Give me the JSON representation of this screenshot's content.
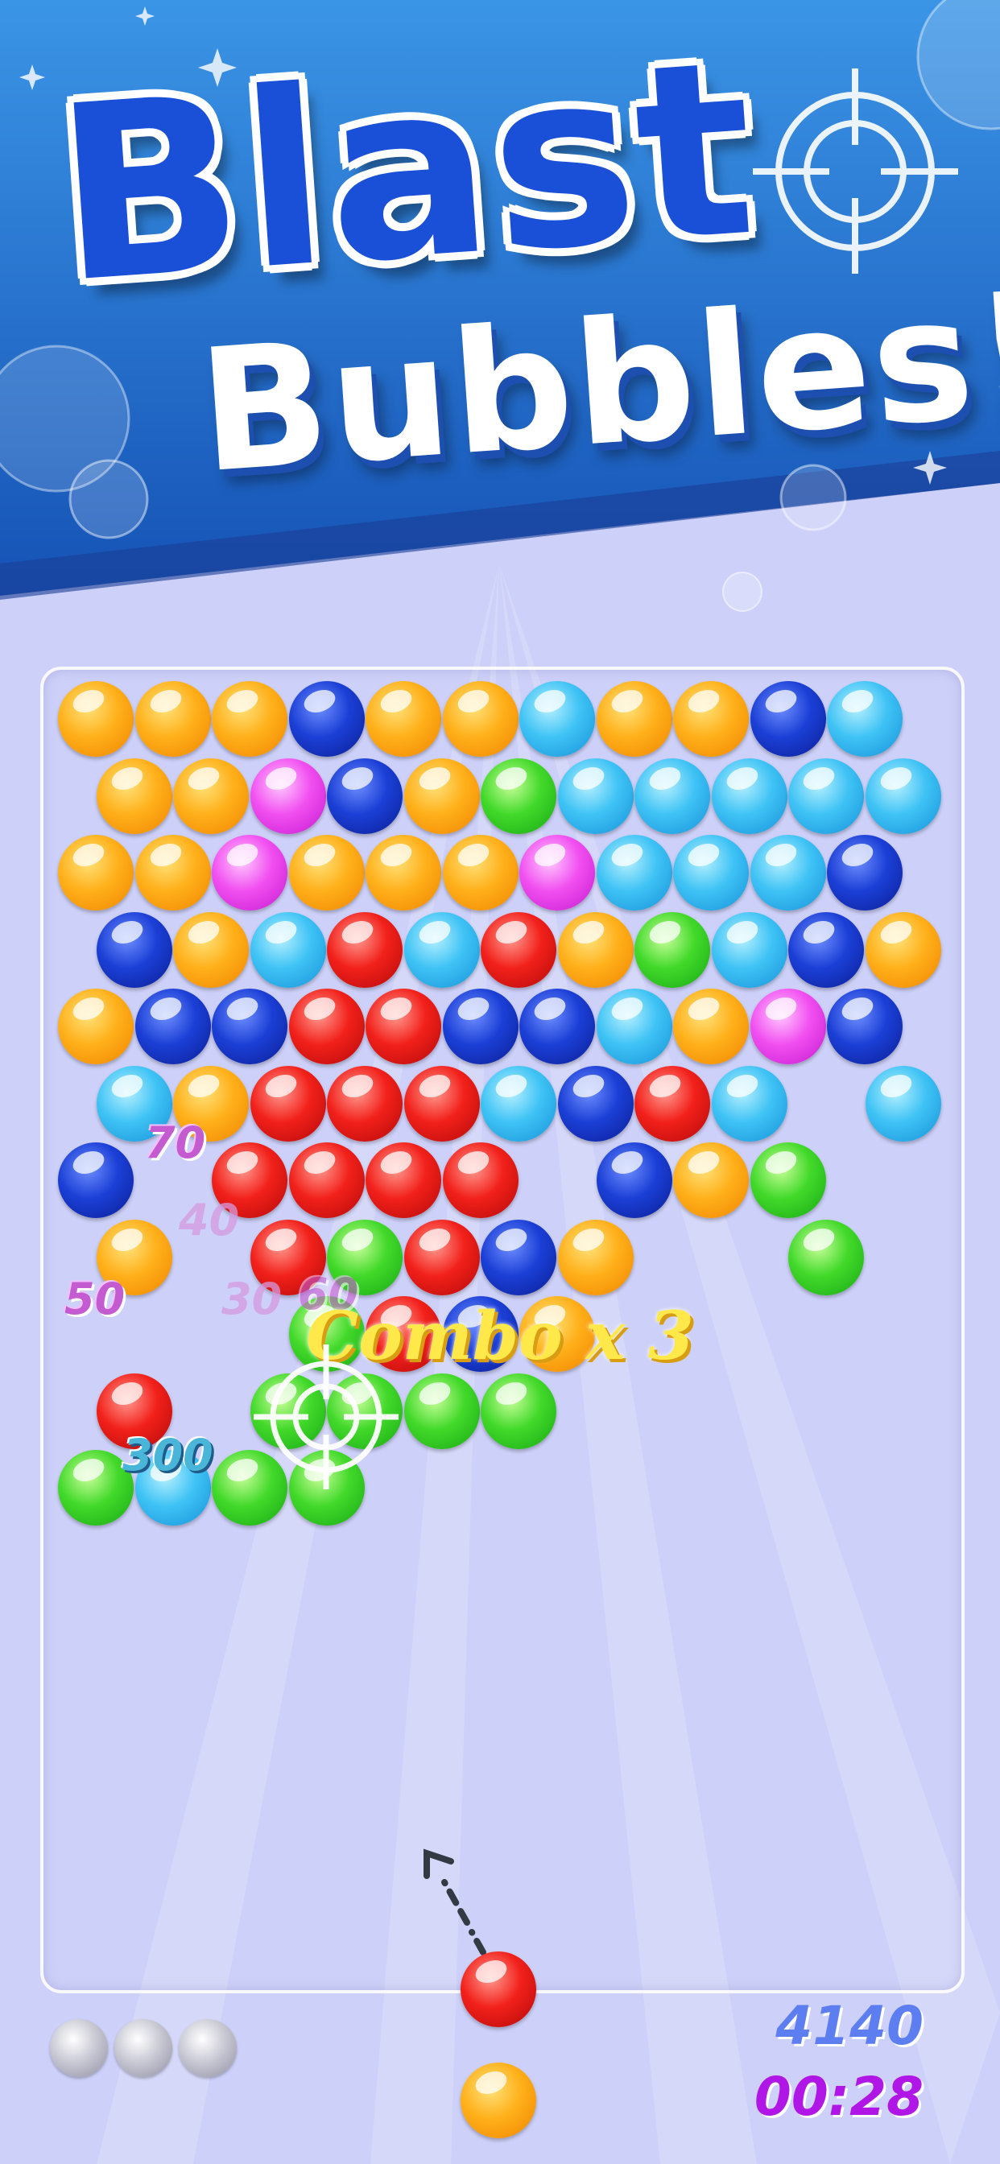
{
  "banner": {
    "title_line1": "Blast",
    "title_line2": "Bubbles!",
    "gradient_top": "#2f86de",
    "gradient_bottom": "#1553b8"
  },
  "board": {
    "colors": {
      "O": "orange",
      "N": "navy",
      "S": "sky",
      "M": "magenta",
      "G": "green",
      "R": "red"
    },
    "rows": [
      "OOONOOSOONS",
      "OOMNOGSSSSS",
      "OOMOOOMSSSN",
      "NOSRSROGSNO",
      "ONNRRNNSOMN",
      "SORRRSNRS.S",
      "N.RRRR.NOG.",
      "O.RGRNO..G.",
      "...GRNO....",
      "R.GGGG.....",
      "GSGG......."
    ]
  },
  "score_popups": [
    "70",
    "40",
    "50",
    "30",
    "60",
    "300"
  ],
  "combo_text": "Combo x 3",
  "shooter": {
    "current": "red",
    "next": "orange"
  },
  "lives_remaining": 3,
  "hud": {
    "score": "4140",
    "timer": "00:28"
  }
}
